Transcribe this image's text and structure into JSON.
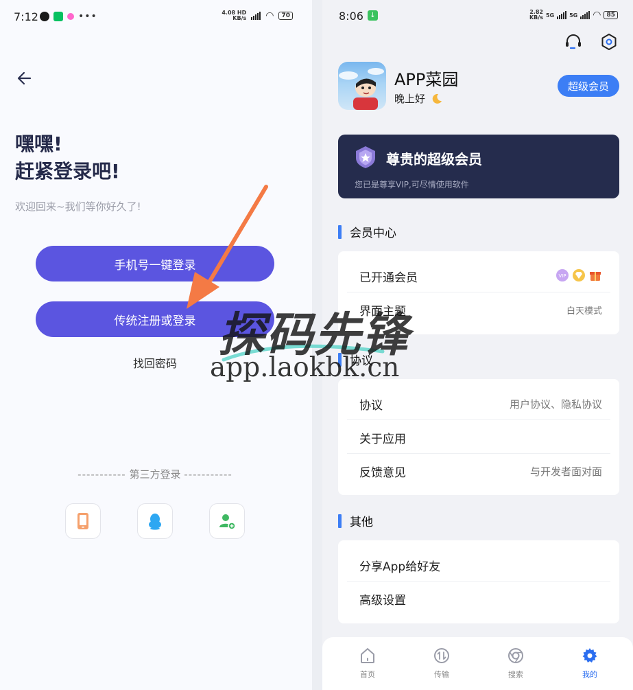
{
  "left": {
    "status": {
      "time": "7:12",
      "speed_value": "4.08",
      "speed_unit": "KB/s",
      "hd": "HD",
      "battery": "70"
    },
    "greeting_line1": "嘿嘿!",
    "greeting_line2": "赶紧登录吧!",
    "welcome": "欢迎回来~我们等你好久了!",
    "phone_login_button": "手机号一键登录",
    "register_login_button": "传统注册或登录",
    "forgot_password": "找回密码",
    "third_party_title": "第三方登录",
    "third_party_dashes": "-----------",
    "third_party_icons": [
      "phone-icon",
      "qq-penguin-icon",
      "user-add-icon"
    ]
  },
  "right": {
    "status": {
      "time": "8:06",
      "speed_value": "2.82",
      "speed_unit": "KB/s",
      "net1": "5G",
      "net2": "5G",
      "battery": "85"
    },
    "app_name": "APP菜园",
    "greeting": "晚上好",
    "super_vip_button": "超级会员",
    "vip_card": {
      "title": "尊贵的超级会员",
      "subtitle": "您已是尊享VIP,可尽情使用软件"
    },
    "sections": [
      {
        "title": "会员中心",
        "rows": [
          {
            "label": "已开通会员",
            "value": ""
          },
          {
            "label": "界面主题",
            "value": "白天模式"
          }
        ]
      },
      {
        "title": "协议",
        "rows": [
          {
            "label": "协议",
            "value": "用户协议、隐私协议"
          },
          {
            "label": "关于应用",
            "value": ""
          },
          {
            "label": "反馈意见",
            "value": "与开发者面对面"
          }
        ]
      },
      {
        "title": "其他",
        "rows": [
          {
            "label": "分享App给好友",
            "value": ""
          },
          {
            "label": "高级设置",
            "value": ""
          }
        ]
      }
    ],
    "tabs": [
      {
        "label": "首页",
        "icon": "home-icon",
        "active": false
      },
      {
        "label": "传输",
        "icon": "transfer-icon",
        "active": false
      },
      {
        "label": "搜索",
        "icon": "search-icon",
        "active": false
      },
      {
        "label": "我的",
        "icon": "gear-icon",
        "active": true
      }
    ]
  },
  "watermark": {
    "text": "探码先锋",
    "url": "app.laokbk.cn"
  },
  "colors": {
    "primary_button": "#5b55e0",
    "accent_blue": "#3c7ef5",
    "vip_card_bg": "#252c4d",
    "arrow": "#f47a45",
    "active_tab": "#2b6ef0"
  }
}
